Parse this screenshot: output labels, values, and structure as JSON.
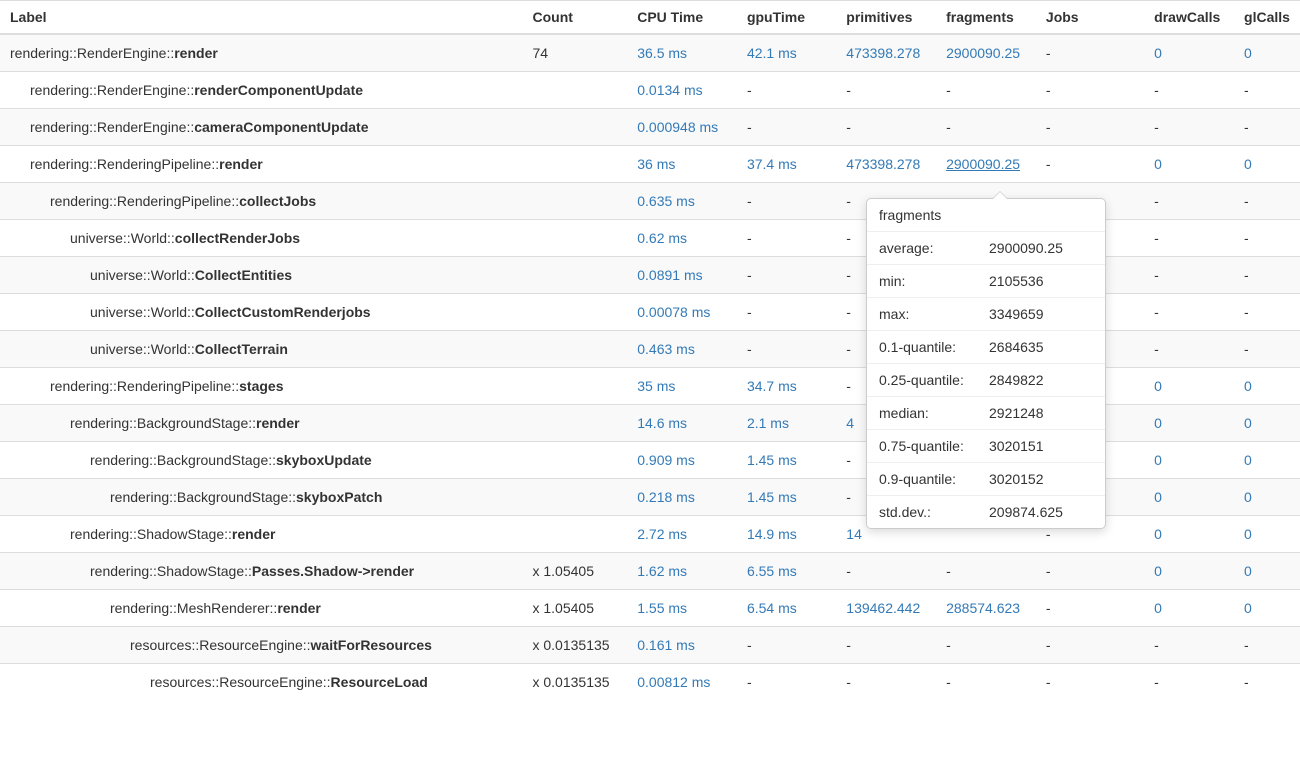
{
  "headers": {
    "label": "Label",
    "count": "Count",
    "cpu": "CPU Time",
    "gpu": "gpuTime",
    "prim": "primitives",
    "frag": "fragments",
    "jobs": "Jobs",
    "draw": "drawCalls",
    "gl": "glCalls"
  },
  "rows": [
    {
      "indent": 0,
      "ns": "rendering::RenderEngine::",
      "method": "render",
      "count": "74",
      "cpu": "36.5 ms",
      "gpu": "42.1 ms",
      "prim": "473398.278",
      "frag": "2900090.25",
      "jobs": "-",
      "draw": "0",
      "gl": "0"
    },
    {
      "indent": 1,
      "ns": "rendering::RenderEngine::",
      "method": "renderComponentUpdate",
      "count": "",
      "cpu": "0.0134 ms",
      "gpu": "-",
      "prim": "-",
      "frag": "-",
      "jobs": "-",
      "draw": "-",
      "gl": "-"
    },
    {
      "indent": 1,
      "ns": "rendering::RenderEngine::",
      "method": "cameraComponentUpdate",
      "count": "",
      "cpu": "0.000948 ms",
      "gpu": "-",
      "prim": "-",
      "frag": "-",
      "jobs": "-",
      "draw": "-",
      "gl": "-"
    },
    {
      "indent": 1,
      "ns": "rendering::RenderingPipeline::",
      "method": "render",
      "count": "",
      "cpu": "36 ms",
      "gpu": "37.4 ms",
      "prim": "473398.278",
      "frag": "2900090.25",
      "frag_underline": true,
      "jobs": "-",
      "draw": "0",
      "gl": "0"
    },
    {
      "indent": 2,
      "ns": "rendering::RenderingPipeline::",
      "method": "collectJobs",
      "count": "",
      "cpu": "0.635 ms",
      "gpu": "-",
      "prim": "-",
      "frag": "",
      "jobs": "-",
      "draw": "-",
      "gl": "-"
    },
    {
      "indent": 3,
      "ns": "universe::World::",
      "method": "collectRenderJobs",
      "count": "",
      "cpu": "0.62 ms",
      "gpu": "-",
      "prim": "-",
      "frag": "",
      "jobs": "-",
      "draw": "-",
      "gl": "-"
    },
    {
      "indent": 4,
      "ns": "universe::World::",
      "method": "CollectEntities",
      "count": "",
      "cpu": "0.0891 ms",
      "gpu": "-",
      "prim": "-",
      "frag": "",
      "jobs": "-",
      "draw": "-",
      "gl": "-"
    },
    {
      "indent": 4,
      "ns": "universe::World::",
      "method": "CollectCustomRenderjobs",
      "count": "",
      "cpu": "0.00078 ms",
      "gpu": "-",
      "prim": "-",
      "frag": "",
      "jobs": "-",
      "draw": "-",
      "gl": "-"
    },
    {
      "indent": 4,
      "ns": "universe::World::",
      "method": "CollectTerrain",
      "count": "",
      "cpu": "0.463 ms",
      "gpu": "-",
      "prim": "-",
      "frag": "",
      "jobs": "-",
      "draw": "-",
      "gl": "-"
    },
    {
      "indent": 2,
      "ns": "rendering::RenderingPipeline::",
      "method": "stages",
      "count": "",
      "cpu": "35 ms",
      "gpu": "34.7 ms",
      "prim": "-",
      "frag": "",
      "jobs": "-",
      "draw": "0",
      "gl": "0"
    },
    {
      "indent": 3,
      "ns": "rendering::BackgroundStage::",
      "method": "render",
      "count": "",
      "cpu": "14.6 ms",
      "gpu": "2.1 ms",
      "prim": "4",
      "frag": "",
      "jobs": "-",
      "draw": "0",
      "gl": "0"
    },
    {
      "indent": 4,
      "ns": "rendering::BackgroundStage::",
      "method": "skyboxUpdate",
      "count": "",
      "cpu": "0.909 ms",
      "gpu": "1.45 ms",
      "prim": "-",
      "frag": "",
      "jobs": "-",
      "draw": "0",
      "gl": "0"
    },
    {
      "indent": 5,
      "ns": "rendering::BackgroundStage::",
      "method": "skyboxPatch",
      "count": "",
      "cpu": "0.218 ms",
      "gpu": "1.45 ms",
      "prim": "-",
      "frag": "",
      "jobs": "-",
      "draw": "0",
      "gl": "0"
    },
    {
      "indent": 3,
      "ns": "rendering::ShadowStage::",
      "method": "render",
      "count": "",
      "cpu": "2.72 ms",
      "gpu": "14.9 ms",
      "prim": "14",
      "prim_partial": true,
      "frag": "",
      "jobs": "-",
      "draw": "0",
      "gl": "0"
    },
    {
      "indent": 4,
      "ns": "rendering::ShadowStage::",
      "method": "Passes.Shadow->render",
      "count": "x 1.05405",
      "cpu": "1.62 ms",
      "gpu": "6.55 ms",
      "prim": "-",
      "frag": "-",
      "jobs": "-",
      "draw": "0",
      "gl": "0"
    },
    {
      "indent": 5,
      "ns": "rendering::MeshRenderer::",
      "method": "render",
      "count": "x 1.05405",
      "cpu": "1.55 ms",
      "gpu": "6.54 ms",
      "prim": "139462.442",
      "frag": "288574.623",
      "jobs": "-",
      "draw": "0",
      "gl": "0"
    },
    {
      "indent": 6,
      "ns": "resources::ResourceEngine::",
      "method": "waitForResources",
      "count": "x 0.0135135",
      "cpu": "0.161 ms",
      "gpu": "-",
      "prim": "-",
      "frag": "-",
      "jobs": "-",
      "draw": "-",
      "gl": "-"
    },
    {
      "indent": 7,
      "ns": "resources::ResourceEngine::",
      "method": "ResourceLoad",
      "count": "x 0.0135135",
      "cpu": "0.00812 ms",
      "gpu": "-",
      "prim": "-",
      "frag": "-",
      "jobs": "-",
      "draw": "-",
      "gl": "-"
    }
  ],
  "tooltip": {
    "title": "fragments",
    "rows": [
      {
        "label": "average:",
        "value": "2900090.25"
      },
      {
        "label": "min:",
        "value": "2105536"
      },
      {
        "label": "max:",
        "value": "3349659"
      },
      {
        "label": "0.1-quantile:",
        "value": "2684635"
      },
      {
        "label": "0.25-quantile:",
        "value": "2849822"
      },
      {
        "label": "median:",
        "value": "2921248"
      },
      {
        "label": "0.75-quantile:",
        "value": "3020151"
      },
      {
        "label": "0.9-quantile:",
        "value": "3020152"
      },
      {
        "label": "std.dev.:",
        "value": "209874.625"
      }
    ]
  }
}
